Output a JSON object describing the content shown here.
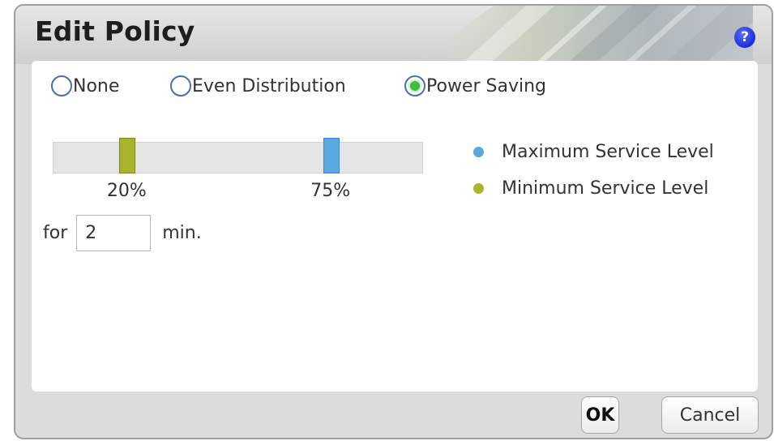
{
  "dialog": {
    "title": "Edit Policy",
    "help_icon": "question-mark-icon",
    "help_glyph": "?"
  },
  "policy_options": [
    {
      "label": "None",
      "selected": false
    },
    {
      "label": "Even Distribution",
      "selected": false
    },
    {
      "label": "Power Saving",
      "selected": true
    }
  ],
  "slider": {
    "min_value": 20,
    "max_value": 75,
    "min_label": "20%",
    "max_label": "75%"
  },
  "legend": {
    "max_label": "Maximum Service Level",
    "min_label": "Minimum Service Level",
    "max_color": "#5aa8e0",
    "min_color": "#a8b42a"
  },
  "duration": {
    "prefix": "for",
    "value": "2",
    "suffix": "min."
  },
  "buttons": {
    "ok": "OK",
    "cancel": "Cancel"
  }
}
